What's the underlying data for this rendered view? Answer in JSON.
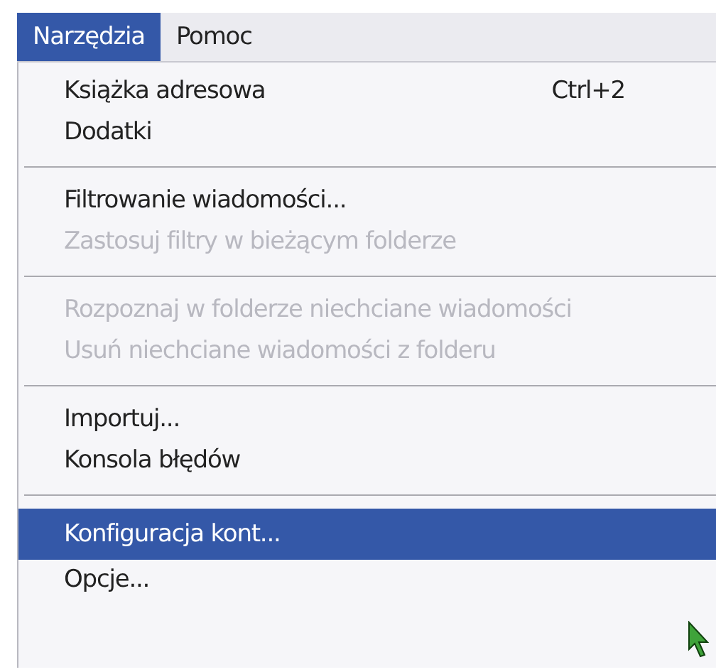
{
  "menubar": [
    {
      "label": "Narzędzia",
      "selected": true
    },
    {
      "label": "Pomoc",
      "selected": false
    }
  ],
  "menu": [
    {
      "kind": "item",
      "label": "Książka adresowa",
      "shortcut": "Ctrl+2",
      "disabled": false,
      "selected": false
    },
    {
      "kind": "item",
      "label": "Dodatki",
      "disabled": false,
      "selected": false
    },
    {
      "kind": "separator"
    },
    {
      "kind": "item",
      "label": "Filtrowanie wiadomości...",
      "disabled": false,
      "selected": false
    },
    {
      "kind": "item",
      "label": "Zastosuj filtry w bieżącym folderze",
      "disabled": true,
      "selected": false
    },
    {
      "kind": "separator"
    },
    {
      "kind": "item",
      "label": "Rozpoznaj w folderze niechciane wiadomości",
      "disabled": true,
      "selected": false
    },
    {
      "kind": "item",
      "label": "Usuń niechciane wiadomości z folderu",
      "disabled": true,
      "selected": false
    },
    {
      "kind": "separator"
    },
    {
      "kind": "item",
      "label": "Importuj...",
      "disabled": false,
      "selected": false
    },
    {
      "kind": "item",
      "label": "Konsola błędów",
      "disabled": false,
      "selected": false
    },
    {
      "kind": "separator"
    },
    {
      "kind": "item",
      "label": "Konfiguracja kont...",
      "disabled": false,
      "selected": true
    },
    {
      "kind": "item",
      "label": "Opcje...",
      "disabled": false,
      "selected": false
    }
  ]
}
